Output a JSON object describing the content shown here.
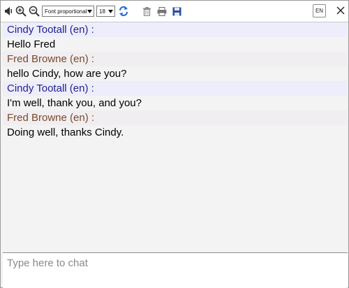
{
  "toolbar": {
    "font_select": "Font proportional",
    "size_select": "18",
    "lang_button": "EN",
    "icons": [
      "volume-icon",
      "zoom-in-icon",
      "zoom-out-icon",
      "refresh-icon",
      "trash-icon",
      "print-icon",
      "save-icon",
      "close-icon"
    ]
  },
  "messages": [
    {
      "sender": "Cindy Tootall (en) :",
      "text": "Hello Fred"
    },
    {
      "sender": "Fred Browne (en) :",
      "text": "hello Cindy, how are you?"
    },
    {
      "sender": "Cindy Tootall (en) :",
      "text": "I'm well, thank you, and you?"
    },
    {
      "sender": "Fred Browne (en) :",
      "text": "Doing well, thanks Cindy."
    }
  ],
  "input": {
    "placeholder": "Type here to chat",
    "value": ""
  },
  "colors": {
    "cindy": "#1f1f8f",
    "fred": "#7a4a2a",
    "refresh": "#2a6fd6",
    "save": "#2a4f9a"
  }
}
